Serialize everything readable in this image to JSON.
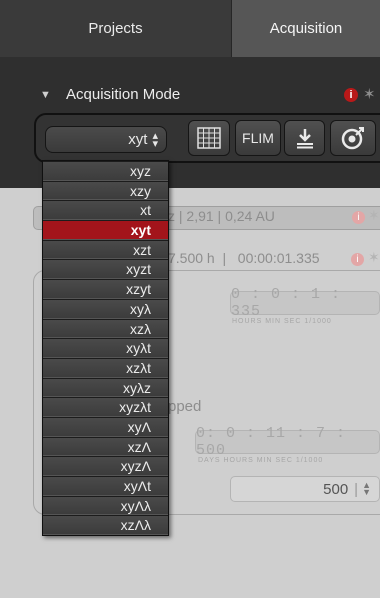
{
  "tabs": [
    {
      "label": "Projects"
    },
    {
      "label": "Acquisition"
    }
  ],
  "acquisition_mode": {
    "title": "Acquisition Mode",
    "info_icon_text": "i",
    "selected_mode": "xyt",
    "flim_label": "FLIM",
    "modes": [
      "xyz",
      "xzy",
      "xt",
      "xyt",
      "xzt",
      "xyzt",
      "xzyt",
      "xyλ",
      "xzλ",
      "xyλt",
      "xzλt",
      "xyλz",
      "xyzλt",
      "xyΛ",
      "xzΛ",
      "xyzΛ",
      "xyΛt",
      "xyΛλ",
      "xzΛλ"
    ],
    "accent_color": "#a3141b"
  },
  "background_panel": {
    "row1_text": "z | 2,91 | 0,24 AU",
    "row2_text": "7.500 h  |   00:00:01.335",
    "time1": "0 : 0 : 1 : 335",
    "time1_units": "HOURS   MIN     SEC    1/1000",
    "stopped_text": "pped",
    "time2": "0: 0 : 11 : 7 : 500",
    "time2_units": "DAYS  HOURS   MIN     SEC    1/1000",
    "count_value": "500"
  }
}
